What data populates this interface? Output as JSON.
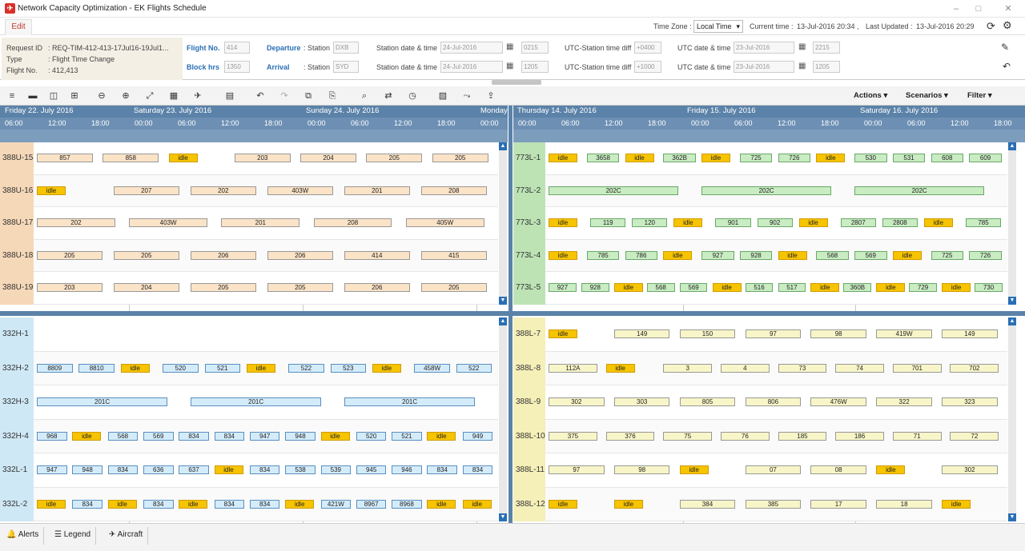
{
  "window": {
    "title": "Network Capacity Optimization - EK Flights Schedule",
    "minimize": "–",
    "maximize": "□",
    "close": "✕"
  },
  "menu": {
    "edit": "Edit"
  },
  "header": {
    "time_zone_label": "Time Zone :",
    "time_zone_value": "Local Time",
    "current_time_label": "Current time :",
    "current_time": "13-Jul-2016 20:34 ,",
    "last_updated_label": "Last Updated :",
    "last_updated": "13-Jul-2016 20:29"
  },
  "request": {
    "id_label": "Request ID",
    "id_value": ": REQ-TIM-412-413-17Jul16-19Jul1...",
    "type_label": "Type",
    "type_value": ": Flight Time Change",
    "flight_label": "Flight No.",
    "flight_value": ": 412,413"
  },
  "flight_info": {
    "flight_no_label": "Flight No.",
    "flight_no": "414",
    "block_label": "Block hrs",
    "block": "1350",
    "dep_label": "Departure",
    "arr_label": "Arrival",
    "station_label": ": Station",
    "dep_station": "DXB",
    "arr_station": "SYD",
    "station_dt_label": "Station date & time",
    "dep_date": "24-Jul-2016",
    "dep_time": "0215",
    "arr_date": "24-Jul-2016",
    "arr_time": "1205",
    "utc_diff_label": "UTC-Station time diff",
    "dep_utc_diff": "+0400",
    "arr_utc_diff": "+1000",
    "utc_dt_label": "UTC date & time",
    "dep_utc_date": "23-Jul-2016",
    "dep_utc_time": "2215",
    "arr_utc_date": "23-Jul-2016",
    "arr_utc_time": "1205"
  },
  "toolbar": {
    "actions": "Actions",
    "scenarios": "Scenarios",
    "filter": "Filter"
  },
  "left_timeline": {
    "days": [
      "Friday 22. July 2016",
      "Saturday 23. July 2016",
      "Sunday 24. July 2016",
      "Monday"
    ],
    "hours": [
      "06:00",
      "12:00",
      "18:00",
      "00:00",
      "06:00",
      "12:00",
      "18:00",
      "00:00",
      "06:00",
      "12:00",
      "18:00",
      "00:00"
    ]
  },
  "right_timeline": {
    "days": [
      "Thursday 14. July 2016",
      "Friday 15. July 2016",
      "Saturday 16. July 2016"
    ],
    "hours": [
      "00:00",
      "06:00",
      "12:00",
      "18:00",
      "00:00",
      "06:00",
      "12:00",
      "18:00",
      "00:00",
      "06:00",
      "12:00",
      "18:00"
    ]
  },
  "lanes_tl": [
    "388U-15",
    "388U-16",
    "388U-17",
    "388U-18",
    "388U-19"
  ],
  "lanes_bl": [
    "332H-1",
    "332H-2",
    "332H-3",
    "332H-4",
    "332L-1",
    "332L-2"
  ],
  "lanes_tr": [
    "773L-1",
    "773L-2",
    "773L-3",
    "773L-4",
    "773L-5"
  ],
  "lanes_br": [
    "388L-7",
    "388L-8",
    "388L-9",
    "388L-10",
    "388L-11",
    "388L-12"
  ],
  "bars": {
    "tl0": [
      "857",
      "858",
      "idle",
      "203",
      "204",
      "205",
      "205"
    ],
    "tl1": [
      "idle",
      "207",
      "202",
      "403W",
      "201",
      "208"
    ],
    "tl2": [
      "202",
      "403W",
      "201",
      "208",
      "405W"
    ],
    "tl3": [
      "205",
      "205",
      "206",
      "206",
      "414",
      "415"
    ],
    "tl4": [
      "203",
      "204",
      "205",
      "205",
      "206",
      "205"
    ],
    "bl1": [
      "8809",
      "8810",
      "idle",
      "520",
      "521",
      "idle",
      "522",
      "523",
      "idle",
      "458W",
      "522"
    ],
    "bl2": [
      "201C",
      "201C",
      "201C"
    ],
    "bl3": [
      "968",
      "idle",
      "568",
      "569",
      "834",
      "834",
      "947",
      "948",
      "idle",
      "520",
      "521",
      "idle",
      "949"
    ],
    "bl4": [
      "947",
      "948",
      "834",
      "636",
      "637",
      "idle",
      "834",
      "538",
      "539",
      "945",
      "946",
      "834",
      "834"
    ],
    "bl5": [
      "idle",
      "834",
      "idle",
      "834",
      "idle",
      "834",
      "834",
      "idle",
      "421W",
      "8967",
      "8968",
      "idle",
      "idle"
    ],
    "tr0": [
      "idle",
      "3658",
      "idle",
      "362B",
      "idle",
      "725",
      "726",
      "idle",
      "530",
      "531",
      "608",
      "609"
    ],
    "tr1": [
      "202C",
      "202C",
      "202C"
    ],
    "tr2": [
      "idle",
      "119",
      "120",
      "idle",
      "901",
      "902",
      "idle",
      "2807",
      "2808",
      "idle",
      "785"
    ],
    "tr3": [
      "idle",
      "785",
      "786",
      "idle",
      "927",
      "928",
      "idle",
      "568",
      "569",
      "idle",
      "725",
      "726"
    ],
    "tr4": [
      "927",
      "928",
      "idle",
      "568",
      "569",
      "idle",
      "516",
      "517",
      "idle",
      "360B",
      "idle",
      "729",
      "idle",
      "730"
    ],
    "br0": [
      "idle",
      "149",
      "150",
      "97",
      "98",
      "419W",
      "149"
    ],
    "br1": [
      "112A",
      "idle",
      "3",
      "4",
      "73",
      "74",
      "701",
      "702"
    ],
    "br2": [
      "302",
      "303",
      "805",
      "806",
      "476W",
      "322",
      "323"
    ],
    "br3": [
      "375",
      "376",
      "75",
      "76",
      "185",
      "186",
      "71",
      "72"
    ],
    "br4": [
      "97",
      "98",
      "idle",
      "07",
      "08",
      "idle",
      "302"
    ],
    "br5": [
      "idle",
      "idle",
      "384",
      "385",
      "17",
      "18",
      "idle"
    ]
  },
  "bottom": {
    "alerts": "Alerts",
    "legend": "Legend",
    "aircraft": "Aircraft"
  }
}
